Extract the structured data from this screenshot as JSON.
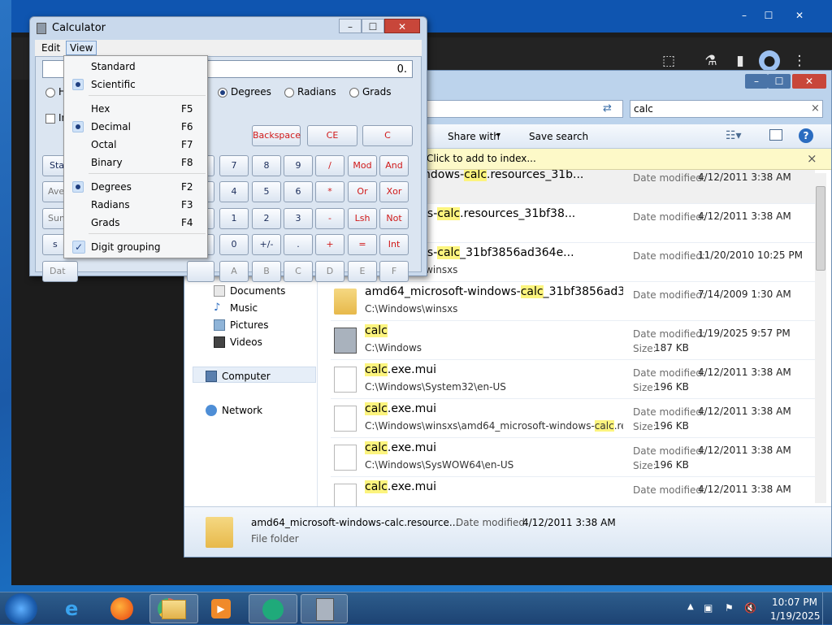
{
  "browser": {
    "title_buttons": [
      "–",
      "☐",
      "✕"
    ]
  },
  "explorer": {
    "title_buttons": [
      "–",
      "☐",
      "✕"
    ],
    "search_value": "calc",
    "search_clear": "×",
    "back_glyph": "⇄",
    "toolbar": {
      "share_with": "Share with",
      "share_arrow": "▾",
      "save_search": "Save search"
    },
    "info_bar": {
      "text": "Click to add to index...",
      "close": "×"
    },
    "nav": [
      {
        "label": "Documents"
      },
      {
        "label": "Music"
      },
      {
        "label": "Pictures"
      },
      {
        "label": "Videos"
      },
      {
        "label": "Computer"
      },
      {
        "label": "Network"
      }
    ],
    "rows": [
      {
        "name_pre": "",
        "name_cut": "icrosoft-windows-",
        "name_hl": "calc",
        "name_post": ".resources_31b...",
        "path_pre": "",
        "path_cut": "winsxs",
        "path_hl": "",
        "path_post": "",
        "label1": "Date modified:",
        "date": "4/12/2011 3:38 AM",
        "label2": "",
        "size": "",
        "icon": "folder"
      },
      {
        "name_pre": "",
        "name_cut": "oft-windows-",
        "name_hl": "calc",
        "name_post": ".resources_31bf38...",
        "path_pre": "",
        "path_cut": "winsxs",
        "path_hl": "",
        "path_post": "",
        "label1": "Date modified:",
        "date": "4/12/2011 3:38 AM",
        "label2": "",
        "size": "",
        "icon": "folder"
      },
      {
        "name_pre": "",
        "name_cut": "oft-windows-",
        "name_hl": "calc",
        "name_post": "_31bf3856ad364e...",
        "path_pre": "C:\\Windows\\winsxs",
        "path_cut": "",
        "path_hl": "",
        "path_post": "",
        "label1": "Date modified:",
        "date": "11/20/2010 10:25 PM",
        "label2": "",
        "size": "",
        "icon": "folder"
      },
      {
        "name_pre": "amd64_microsoft-windows-",
        "name_cut": "",
        "name_hl": "calc",
        "name_post": "_31bf3856ad3...",
        "path_pre": "C:\\Windows\\winsxs",
        "path_cut": "",
        "path_hl": "",
        "path_post": "",
        "label1": "Date modified:",
        "date": "7/14/2009 1:30 AM",
        "label2": "",
        "size": "",
        "icon": "folder"
      },
      {
        "name_pre": "",
        "name_cut": "",
        "name_hl": "calc",
        "name_post": "",
        "path_pre": "C:\\Windows",
        "path_cut": "",
        "path_hl": "",
        "path_post": "",
        "label1": "Date modified:",
        "date": "1/19/2025 9:57 PM",
        "label2": "Size:",
        "size": "187 KB",
        "icon": "calculator"
      },
      {
        "name_pre": "",
        "name_cut": "",
        "name_hl": "calc",
        "name_post": ".exe.mui",
        "path_pre": "C:\\Windows\\System32\\en-US",
        "path_cut": "",
        "path_hl": "",
        "path_post": "",
        "label1": "Date modified:",
        "date": "4/12/2011 3:38 AM",
        "label2": "Size:",
        "size": "196 KB",
        "icon": "document"
      },
      {
        "name_pre": "",
        "name_cut": "",
        "name_hl": "calc",
        "name_post": ".exe.mui",
        "path_pre": "C:\\Windows\\winsxs\\amd64_microsoft-windows-",
        "path_cut": "",
        "path_hl": "calc",
        "path_post": ".reso...",
        "label1": "Date modified:",
        "date": "4/12/2011 3:38 AM",
        "label2": "Size:",
        "size": "196 KB",
        "icon": "document"
      },
      {
        "name_pre": "",
        "name_cut": "",
        "name_hl": "calc",
        "name_post": ".exe.mui",
        "path_pre": "C:\\Windows\\SysWOW64\\en-US",
        "path_cut": "",
        "path_hl": "",
        "path_post": "",
        "label1": "Date modified:",
        "date": "4/12/2011 3:38 AM",
        "label2": "Size:",
        "size": "196 KB",
        "icon": "document"
      },
      {
        "name_pre": "",
        "name_cut": "",
        "name_hl": "calc",
        "name_post": ".exe.mui",
        "path_pre": "",
        "path_cut": "",
        "path_hl": "",
        "path_post": "",
        "label1": "Date modified:",
        "date": "4/12/2011 3:38 AM",
        "label2": "",
        "size": "",
        "icon": "document"
      }
    ],
    "details": {
      "name": "amd64_microsoft-windows-calc.resource...",
      "date_label": "Date modified:",
      "date": "4/12/2011 3:38 AM",
      "type": "File folder"
    }
  },
  "calculator": {
    "title": "Calculator",
    "title_buttons": [
      "–",
      "☐",
      "✕"
    ],
    "menu": {
      "edit": "Edit",
      "view": "View"
    },
    "display": "0.",
    "angle": {
      "degrees": "Degrees",
      "radians": "Radians",
      "grads": "Grads"
    },
    "left_fragments": {
      "h": "H",
      "inv": "In",
      "sta": "Sta",
      "ave": "Ave",
      "sum": "Sum",
      "s": "s",
      "dat": "Dat"
    },
    "edit_keys": [
      "Backspace",
      "CE",
      "C"
    ],
    "keypad": [
      [
        "7",
        "8",
        "9",
        "/",
        "Mod",
        "And"
      ],
      [
        "4",
        "5",
        "6",
        "*",
        "Or",
        "Xor"
      ],
      [
        "1",
        "2",
        "3",
        "-",
        "Lsh",
        "Not"
      ],
      [
        "0",
        "+/-",
        ".",
        "+",
        "=",
        "Int"
      ],
      [
        "A",
        "B",
        "C",
        "D",
        "E",
        "F"
      ]
    ]
  },
  "view_menu": {
    "items": [
      {
        "label": "Standard",
        "key": "",
        "mark": ""
      },
      {
        "label": "Scientific",
        "key": "",
        "mark": "bullet"
      },
      {
        "label": "Hex",
        "key": "F5",
        "mark": ""
      },
      {
        "label": "Decimal",
        "key": "F6",
        "mark": "bullet"
      },
      {
        "label": "Octal",
        "key": "F7",
        "mark": ""
      },
      {
        "label": "Binary",
        "key": "F8",
        "mark": ""
      },
      {
        "label": "Degrees",
        "key": "F2",
        "mark": "bullet"
      },
      {
        "label": "Radians",
        "key": "F3",
        "mark": ""
      },
      {
        "label": "Grads",
        "key": "F4",
        "mark": ""
      },
      {
        "label": "Digit grouping",
        "key": "",
        "mark": "check"
      }
    ]
  },
  "taskbar": {
    "clock_time": "10:07 PM",
    "clock_date": "1/19/2025"
  }
}
